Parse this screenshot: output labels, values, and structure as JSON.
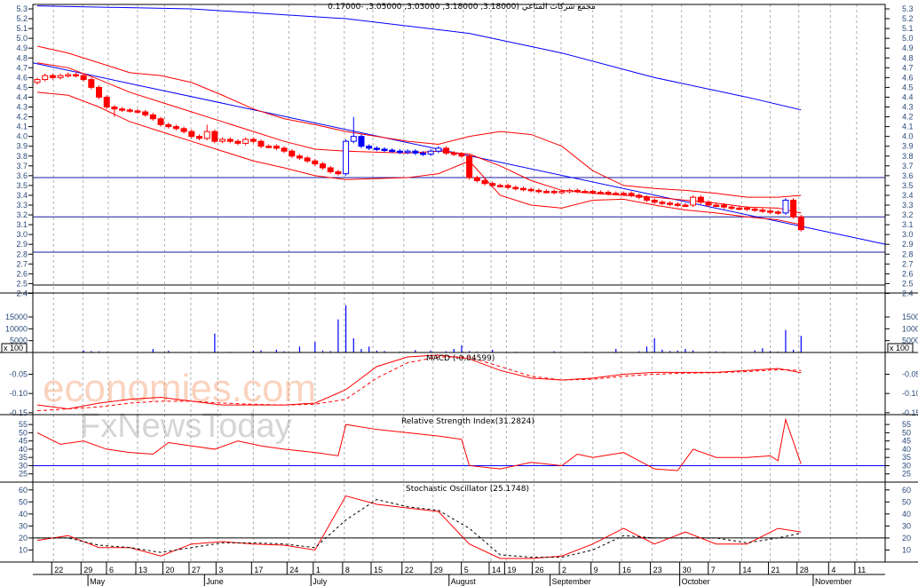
{
  "title": "مجمع شركات المناعي (3.18000, 3.18000, 3.03000, 3.05000, -0.17000",
  "watermark": {
    "line1": "economies.com",
    "line2": "FxNewsToday"
  },
  "colors": {
    "down": "#ff0000",
    "up_blue": "#0000ff",
    "ma": "#0000ff",
    "bands": "#ff0000",
    "macd": "#ff0000",
    "rsi": "#ff0000",
    "stoch_k": "#ff0000",
    "stoch_d": "#000000",
    "level": "#0000ff"
  },
  "chart_data": {
    "type": "candlestick",
    "price_axis": {
      "ylim": [
        2.4,
        5.3
      ],
      "ticks": [
        "5.3",
        "5.2",
        "5.1",
        "5.0",
        "4.9",
        "4.8",
        "4.7",
        "4.6",
        "4.5",
        "4.4",
        "4.3",
        "4.2",
        "4.1",
        "4.0",
        "3.9",
        "3.8",
        "3.7",
        "3.6",
        "3.5",
        "3.4",
        "3.3",
        "3.2",
        "3.1",
        "3.0",
        "2.9",
        "2.8",
        "2.7",
        "2.6",
        "2.5",
        "2.4"
      ]
    },
    "first_open": 4.55,
    "close": [
      4.58,
      4.62,
      4.6,
      4.62,
      4.63,
      4.62,
      4.58,
      4.5,
      4.4,
      4.3,
      4.28,
      4.27,
      4.26,
      4.25,
      4.22,
      4.18,
      4.12,
      4.1,
      4.08,
      4.05,
      4.0,
      3.98,
      4.05,
      3.95,
      3.97,
      3.95,
      3.93,
      3.97,
      3.95,
      3.9,
      3.9,
      3.88,
      3.85,
      3.8,
      3.78,
      3.75,
      3.72,
      3.68,
      3.64,
      3.62,
      3.95,
      4.0,
      3.9,
      3.88,
      3.87,
      3.86,
      3.85,
      3.84,
      3.85,
      3.83,
      3.82,
      3.85,
      3.88,
      3.83,
      3.82,
      3.8,
      3.58,
      3.55,
      3.52,
      3.5,
      3.5,
      3.48,
      3.47,
      3.46,
      3.45,
      3.44,
      3.44,
      3.43,
      3.44,
      3.45,
      3.44,
      3.44,
      3.43,
      3.43,
      3.42,
      3.42,
      3.42,
      3.4,
      3.38,
      3.35,
      3.33,
      3.32,
      3.31,
      3.3,
      3.3,
      3.38,
      3.33,
      3.3,
      3.3,
      3.28,
      3.27,
      3.27,
      3.26,
      3.25,
      3.24,
      3.23,
      3.22,
      3.35,
      3.18,
      3.05
    ],
    "blue_candles": [
      40,
      41,
      42,
      43,
      44,
      45,
      46,
      47,
      48,
      49,
      50,
      51,
      52,
      97
    ],
    "extra_highs": {
      "41": 4.2,
      "22": 4.12
    },
    "extra_lows": {
      "10": 4.2,
      "99": 3.03
    },
    "moving_average": [
      [
        0,
        5.33
      ],
      [
        20,
        5.3
      ],
      [
        40,
        5.2
      ],
      [
        56,
        5.05
      ],
      [
        68,
        4.85
      ],
      [
        80,
        4.6
      ],
      [
        92,
        4.4
      ],
      [
        99,
        4.27
      ]
    ],
    "trend_line": [
      [
        -0.6,
        4.75
      ],
      [
        110,
        2.9
      ]
    ],
    "horizontal_levels": [
      3.58,
      3.18,
      2.82
    ],
    "bollinger_index": [
      0,
      4,
      8,
      12,
      16,
      20,
      24,
      28,
      32,
      36,
      40,
      44,
      48,
      52,
      56,
      60,
      64,
      68,
      72,
      76,
      80,
      84,
      88,
      92,
      96,
      99
    ],
    "bollinger_upper": [
      4.92,
      4.85,
      4.75,
      4.65,
      4.62,
      4.55,
      4.42,
      4.28,
      4.18,
      4.12,
      4.05,
      4.0,
      3.95,
      3.92,
      4.0,
      4.05,
      4.02,
      3.9,
      3.65,
      3.5,
      3.47,
      3.45,
      3.42,
      3.38,
      3.38,
      3.4
    ],
    "bollinger_middle": [
      4.75,
      4.7,
      4.58,
      4.45,
      4.35,
      4.25,
      4.15,
      4.05,
      3.95,
      3.87,
      3.85,
      3.84,
      3.83,
      3.85,
      3.82,
      3.7,
      3.55,
      3.45,
      3.42,
      3.4,
      3.38,
      3.35,
      3.32,
      3.28,
      3.27,
      3.22
    ],
    "bollinger_lower": [
      4.45,
      4.42,
      4.3,
      4.15,
      4.05,
      3.95,
      3.85,
      3.75,
      3.68,
      3.6,
      3.56,
      3.57,
      3.58,
      3.62,
      3.75,
      3.4,
      3.3,
      3.27,
      3.35,
      3.36,
      3.3,
      3.25,
      3.22,
      3.18,
      3.15,
      3.1
    ],
    "volume": {
      "unit_label": "x 100",
      "ticks": [
        "15000",
        "10000",
        "5000"
      ],
      "ylim": [
        0,
        24000
      ],
      "values": [
        0,
        0,
        0,
        0,
        0,
        0,
        900,
        600,
        500,
        300,
        0,
        0,
        0,
        0,
        0,
        1500,
        0,
        700,
        0,
        0,
        0,
        300,
        0,
        8000,
        0,
        300,
        0,
        0,
        800,
        900,
        0,
        1200,
        500,
        0,
        2500,
        0,
        4500,
        800,
        600,
        14000,
        20000,
        6000,
        1500,
        2500,
        800,
        600,
        0,
        400,
        300,
        1000,
        0,
        800,
        0,
        500,
        1500,
        3000,
        600,
        400,
        300,
        1200,
        0,
        200,
        300,
        0,
        0,
        200,
        0,
        500,
        0,
        0,
        0,
        300,
        0,
        0,
        0,
        1500,
        0,
        0,
        500,
        2500,
        6000,
        1200,
        600,
        800,
        1500,
        900,
        0,
        300,
        500,
        300,
        0,
        0,
        0,
        900,
        1800,
        600,
        400,
        9500,
        1200,
        7000
      ]
    },
    "macd": {
      "label": "MACD (-0.04599)",
      "ticks": [
        "-0.05",
        "-0.10",
        "-0.15"
      ],
      "ylim": [
        -0.155,
        0.002
      ],
      "index": [
        0,
        4,
        8,
        12,
        16,
        20,
        24,
        28,
        32,
        36,
        40,
        44,
        48,
        52,
        56,
        60,
        64,
        68,
        72,
        76,
        80,
        84,
        88,
        92,
        96,
        99
      ],
      "line": [
        -0.13,
        -0.14,
        -0.125,
        -0.115,
        -0.11,
        -0.12,
        -0.13,
        -0.13,
        -0.13,
        -0.125,
        -0.09,
        -0.03,
        -0.005,
        0.0,
        -0.01,
        -0.04,
        -0.06,
        -0.065,
        -0.06,
        -0.05,
        -0.045,
        -0.045,
        -0.045,
        -0.04,
        -0.035,
        -0.046
      ],
      "signal": [
        -0.145,
        -0.14,
        -0.135,
        -0.125,
        -0.12,
        -0.12,
        -0.125,
        -0.128,
        -0.13,
        -0.128,
        -0.115,
        -0.06,
        -0.02,
        -0.005,
        -0.005,
        -0.03,
        -0.055,
        -0.065,
        -0.063,
        -0.055,
        -0.05,
        -0.047,
        -0.046,
        -0.043,
        -0.038,
        -0.04
      ]
    },
    "rsi": {
      "label": "Relative Strength Index(31.2824)",
      "ticks": [
        "55",
        "50",
        "45",
        "40",
        "35",
        "30",
        "25"
      ],
      "ylim": [
        20,
        61
      ],
      "level": 30,
      "points": [
        [
          0,
          50
        ],
        [
          3,
          43
        ],
        [
          6,
          45
        ],
        [
          9,
          40
        ],
        [
          12,
          38
        ],
        [
          15,
          37
        ],
        [
          17,
          44
        ],
        [
          20,
          42
        ],
        [
          23,
          40
        ],
        [
          26,
          45
        ],
        [
          29,
          42
        ],
        [
          32,
          40
        ],
        [
          36,
          38
        ],
        [
          39,
          36
        ],
        [
          40,
          55
        ],
        [
          44,
          52
        ],
        [
          48,
          50
        ],
        [
          52,
          48
        ],
        [
          55,
          46
        ],
        [
          56,
          30
        ],
        [
          60,
          28
        ],
        [
          64,
          32
        ],
        [
          68,
          30
        ],
        [
          70,
          37
        ],
        [
          72,
          35
        ],
        [
          76,
          38
        ],
        [
          80,
          28
        ],
        [
          83,
          27
        ],
        [
          85,
          40
        ],
        [
          88,
          35
        ],
        [
          92,
          35
        ],
        [
          95,
          36
        ],
        [
          96,
          33
        ],
        [
          97,
          58
        ],
        [
          99,
          31
        ]
      ]
    },
    "stochastic": {
      "label": "Stochastic Oscillator (25.1748)",
      "ticks": [
        "60",
        "50",
        "40",
        "30",
        "20",
        "10"
      ],
      "ylim": [
        0,
        65
      ],
      "level": 20,
      "index": [
        0,
        4,
        8,
        12,
        16,
        20,
        24,
        28,
        32,
        36,
        40,
        44,
        48,
        52,
        56,
        60,
        64,
        68,
        72,
        76,
        80,
        84,
        88,
        92,
        96,
        99
      ],
      "k": [
        18,
        22,
        12,
        12,
        5,
        15,
        17,
        15,
        14,
        10,
        55,
        48,
        45,
        42,
        15,
        3,
        3,
        5,
        15,
        28,
        15,
        25,
        15,
        15,
        28,
        25
      ],
      "d": [
        20,
        20,
        14,
        12,
        8,
        12,
        16,
        16,
        15,
        12,
        35,
        52,
        46,
        43,
        28,
        6,
        4,
        4,
        10,
        22,
        20,
        20,
        20,
        16,
        20,
        24
      ]
    },
    "x_axis": {
      "days": [
        [
          "22",
          2.1
        ],
        [
          "29",
          5.9
        ],
        [
          "6",
          9.2
        ],
        [
          "13",
          13
        ],
        [
          "20",
          16.5
        ],
        [
          "27",
          19.9
        ],
        [
          "3",
          23.4
        ],
        [
          "17",
          28
        ],
        [
          "24",
          32.6
        ],
        [
          "1",
          36
        ],
        [
          "8",
          39.8
        ],
        [
          "15",
          43.5
        ],
        [
          "22",
          47.5
        ],
        [
          "29",
          51.3
        ],
        [
          "5",
          55.2
        ],
        [
          "14",
          58.8
        ],
        [
          "19",
          60.8
        ],
        [
          "26",
          64.4
        ],
        [
          "2",
          67.9
        ],
        [
          "9",
          72
        ],
        [
          "16",
          75.7
        ],
        [
          "23",
          79.7
        ],
        [
          "30",
          83.5
        ],
        [
          "7",
          87.2
        ],
        [
          "14",
          91.3
        ],
        [
          "21",
          95
        ],
        [
          "28",
          98.7
        ],
        [
          "4",
          102.8
        ],
        [
          "11",
          106.2
        ]
      ],
      "months": [
        [
          "May",
          6.8
        ],
        [
          "June",
          21.9
        ],
        [
          "July",
          35.7
        ],
        [
          "August",
          53.6
        ],
        [
          "September",
          66.7
        ],
        [
          "October",
          83.5
        ],
        [
          "November",
          100.8
        ]
      ]
    }
  }
}
